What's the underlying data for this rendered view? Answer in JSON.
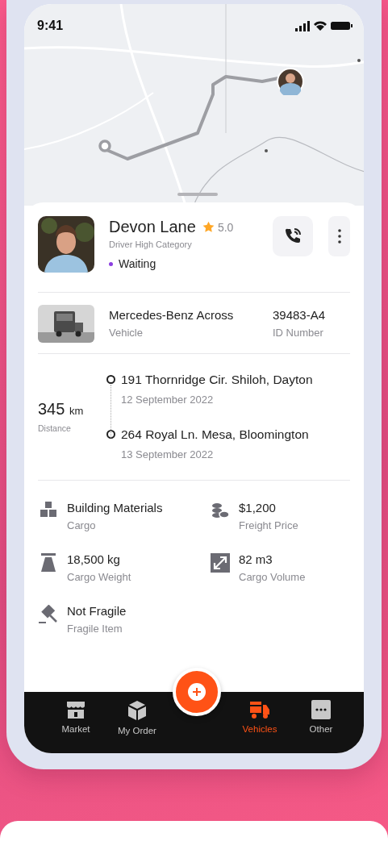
{
  "status_bar": {
    "time": "9:41"
  },
  "driver": {
    "name": "Devon Lane",
    "rating": "5.0",
    "category": "Driver High Category",
    "status": "Waiting"
  },
  "vehicle": {
    "model": "Mercedes-Benz Across",
    "model_label": "Vehicle",
    "id": "39483-A4",
    "id_label": "ID Number"
  },
  "route": {
    "distance": "345",
    "unit": "km",
    "distance_label": "Distance",
    "stops": [
      {
        "address": "191 Thornridge Cir. Shiloh, Dayton",
        "date": "12 September 2022"
      },
      {
        "address": "264 Royal Ln. Mesa, Bloomington",
        "date": "13 September 2022"
      }
    ]
  },
  "cargo": [
    {
      "kind": "blocks",
      "value": "Building Materials",
      "label": "Cargo"
    },
    {
      "kind": "coins",
      "value": "$1,200",
      "label": "Freight Price"
    },
    {
      "kind": "scale",
      "value": "18,500 kg",
      "label": "Cargo Weight"
    },
    {
      "kind": "resize",
      "value": "82 m3",
      "label": "Cargo Volume"
    },
    {
      "kind": "hammer",
      "value": "Not Fragile",
      "label": "Fragile Item"
    }
  ],
  "nav": [
    {
      "kind": "store",
      "label": "Market",
      "selected": false
    },
    {
      "kind": "box",
      "label": "My Order",
      "selected": false
    },
    {
      "kind": "truck",
      "label": "Vehicles",
      "selected": true
    },
    {
      "kind": "more",
      "label": "Other",
      "selected": false
    }
  ]
}
